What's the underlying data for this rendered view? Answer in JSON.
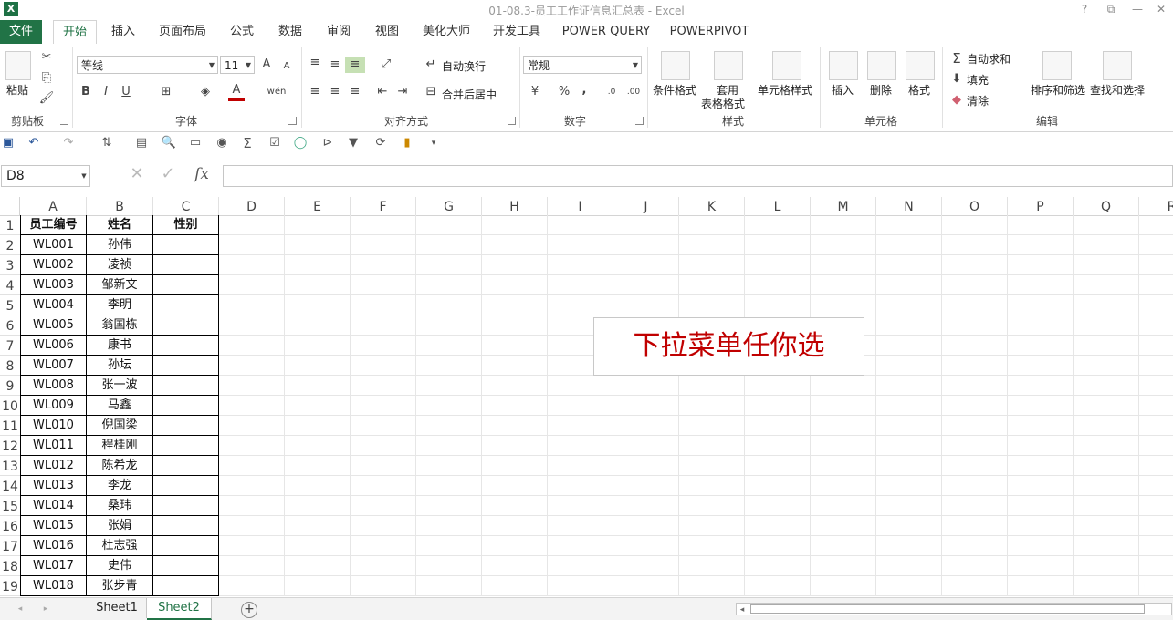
{
  "window": {
    "title": "01-08.3-员工工作证信息汇总表 - Excel",
    "app_icon": "X",
    "help": "?",
    "restore": "⧉",
    "minimize": "—",
    "close": "✕"
  },
  "tabs": [
    {
      "label": "文件"
    },
    {
      "label": "开始"
    },
    {
      "label": "插入"
    },
    {
      "label": "页面布局"
    },
    {
      "label": "公式"
    },
    {
      "label": "数据"
    },
    {
      "label": "审阅"
    },
    {
      "label": "视图"
    },
    {
      "label": "美化大师"
    },
    {
      "label": "开发工具"
    },
    {
      "label": "POWER QUERY"
    },
    {
      "label": "POWERPIVOT"
    }
  ],
  "ribbon": {
    "clipboard": {
      "paste": "粘贴",
      "group": "剪贴板"
    },
    "font": {
      "name": "等线",
      "size": "11",
      "bold": "B",
      "italic": "I",
      "underline": "U",
      "grow": "A",
      "shrink": "A",
      "font_color": "A",
      "phonetic": "wén",
      "group": "字体"
    },
    "align": {
      "wrap": "自动换行",
      "merge": "合并后居中",
      "group": "对齐方式"
    },
    "number": {
      "format": "常规",
      "percent": "%",
      "comma": ",",
      "group": "数字"
    },
    "styles": {
      "cond": "条件格式",
      "table1": "套用",
      "table2": "表格格式",
      "cell": "单元格样式",
      "group": "样式"
    },
    "cells": {
      "insert": "插入",
      "delete": "删除",
      "format": "格式",
      "group": "单元格"
    },
    "editing": {
      "autosum": "自动求和",
      "fill": "填充",
      "clear": "清除",
      "sort": "排序和筛选",
      "find": "查找和选择",
      "group": "编辑"
    }
  },
  "formula_bar": {
    "name_box": "D8",
    "fx": "fx",
    "cancel": "✕",
    "enter": "✓"
  },
  "columns": [
    "A",
    "B",
    "C",
    "D",
    "E",
    "F",
    "G",
    "H",
    "I",
    "J",
    "K",
    "L",
    "M",
    "N",
    "O",
    "P",
    "Q",
    "R"
  ],
  "rows": [
    "1",
    "2",
    "3",
    "4",
    "5",
    "6",
    "7",
    "8",
    "9",
    "10",
    "11",
    "12",
    "13",
    "14",
    "15",
    "16",
    "17",
    "18",
    "19"
  ],
  "table": {
    "headers": [
      "员工编号",
      "姓名",
      "性别"
    ],
    "data": [
      [
        "WL001",
        "孙伟"
      ],
      [
        "WL002",
        "凌祯"
      ],
      [
        "WL003",
        "邹新文"
      ],
      [
        "WL004",
        "李明"
      ],
      [
        "WL005",
        "翁国栋"
      ],
      [
        "WL006",
        "康书"
      ],
      [
        "WL007",
        "孙坛"
      ],
      [
        "WL008",
        "张一波"
      ],
      [
        "WL009",
        "马鑫"
      ],
      [
        "WL010",
        "倪国梁"
      ],
      [
        "WL011",
        "程桂刚"
      ],
      [
        "WL012",
        "陈希龙"
      ],
      [
        "WL013",
        "李龙"
      ],
      [
        "WL014",
        "桑玮"
      ],
      [
        "WL015",
        "张娟"
      ],
      [
        "WL016",
        "杜志强"
      ],
      [
        "WL017",
        "史伟"
      ],
      [
        "WL018",
        "张步青"
      ]
    ]
  },
  "callout": {
    "text": "下拉菜单任你选",
    "color": "#c00000"
  },
  "sheets": [
    {
      "label": "Sheet1"
    },
    {
      "label": "Sheet2"
    }
  ],
  "sheet_add": "+",
  "colors": {
    "accent": "#217346"
  }
}
